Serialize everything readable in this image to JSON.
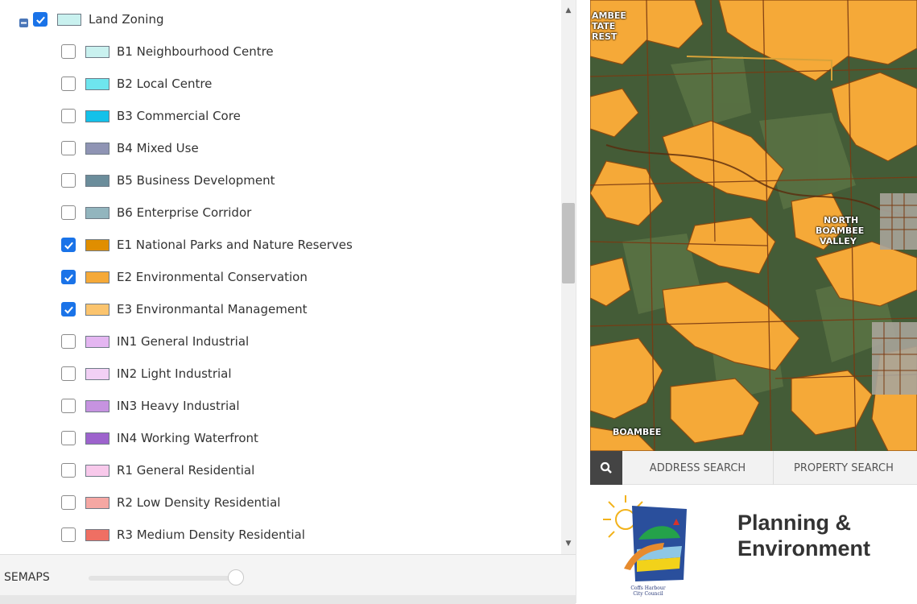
{
  "layer_panel": {
    "group": {
      "label": "Land Zoning",
      "checked": true,
      "swatch": "#c9f1ef",
      "collapse_icon": "minus-square-icon"
    },
    "items": [
      {
        "label": "B1 Neighbourhood Centre",
        "checked": false,
        "color": "#c9f1ef"
      },
      {
        "label": "B2 Local Centre",
        "checked": false,
        "color": "#6ee5ee"
      },
      {
        "label": "B3 Commercial Core",
        "checked": false,
        "color": "#14c1e9"
      },
      {
        "label": "B4 Mixed Use",
        "checked": false,
        "color": "#8f94b4"
      },
      {
        "label": "B5 Business Development",
        "checked": false,
        "color": "#6b8d9b"
      },
      {
        "label": "B6 Enterprise Corridor",
        "checked": false,
        "color": "#92b5be"
      },
      {
        "label": "E1 National Parks and Nature Reserves",
        "checked": true,
        "color": "#e08e00"
      },
      {
        "label": "E2 Environmental Conservation",
        "checked": true,
        "color": "#f5a938"
      },
      {
        "label": "E3 Environmantal Management",
        "checked": true,
        "color": "#fbc46e"
      },
      {
        "label": "IN1 General Industrial",
        "checked": false,
        "color": "#e4b6f1"
      },
      {
        "label": "IN2 Light Industrial",
        "checked": false,
        "color": "#f2d0f5"
      },
      {
        "label": "IN3 Heavy Industrial",
        "checked": false,
        "color": "#c693e0"
      },
      {
        "label": "IN4 Working Waterfront",
        "checked": false,
        "color": "#9d63cd"
      },
      {
        "label": "R1 General Residential",
        "checked": false,
        "color": "#f8c9eb"
      },
      {
        "label": "R2 Low Density Residential",
        "checked": false,
        "color": "#f5a7a3"
      },
      {
        "label": "R3 Medium Density Residential",
        "checked": false,
        "color": "#ef6f63"
      }
    ]
  },
  "basemaps": {
    "label": "SEMAPS",
    "opacity_fraction": 0.97
  },
  "map": {
    "labels": [
      "AMBEE",
      "TATE",
      "REST",
      "NORTH",
      "BOAMBEE",
      "VALLEY",
      "BOAMBEE"
    ]
  },
  "search": {
    "icon": "search-icon",
    "address_tab": "ADDRESS SEARCH",
    "property_tab": "PROPERTY SEARCH"
  },
  "brand": {
    "title_line1": "Planning &",
    "title_line2": "Environment",
    "logo_text_line1": "Coffs Harbour",
    "logo_text_line2": "City Council"
  },
  "colors": {
    "checkbox_checked": "#1a73e8",
    "zone_fill": "#f5a938",
    "search_button": "#444444"
  }
}
